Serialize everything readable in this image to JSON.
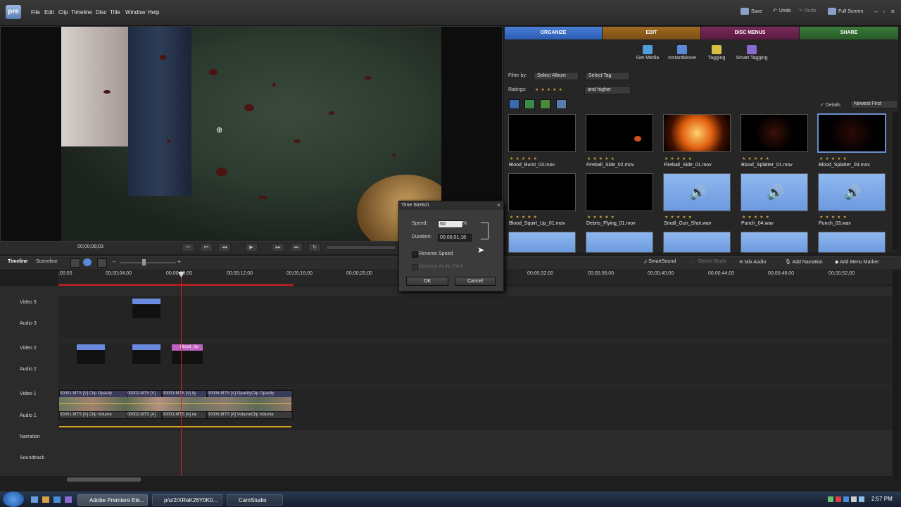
{
  "app": {
    "logo": "pre"
  },
  "menu": [
    "File",
    "Edit",
    "Clip",
    "Timeline",
    "Disc",
    "Title",
    "Window",
    "Help"
  ],
  "toolbar": {
    "save": "Save",
    "undo": "Undo",
    "redo": "Redo",
    "fullscreen": "Full Screen"
  },
  "monitor": {
    "timecode": "00;00;08;03"
  },
  "tabs": {
    "organize": "ORGANIZE",
    "edit": "EDIT",
    "disc_menus": "DISC MENUS",
    "share": "SHARE"
  },
  "tools": {
    "get_media": "Get Media",
    "instant_movie": "InstantMovie",
    "tagging": "Tagging",
    "smart_tagging": "Smart Tagging"
  },
  "filter": {
    "filter_by": "Filter by:",
    "album": "Select Album",
    "tag": "Select Tag",
    "ratings": "Ratings:",
    "and_higher": "and higher",
    "details": "Details",
    "sort": "Newest First"
  },
  "media": [
    {
      "name": "Blood_Burst_03.mov"
    },
    {
      "name": "Fireball_Side_02.mov"
    },
    {
      "name": "Fireball_Side_01.mov"
    },
    {
      "name": "Blood_Splatter_01.mov"
    },
    {
      "name": "Blood_Splatter_03.mov"
    },
    {
      "name": "Blood_Squirt_Up_01.mov"
    },
    {
      "name": "Debris_Flying_01.mov"
    },
    {
      "name": "Small_Gun_Shot.wav"
    },
    {
      "name": "Punch_04.wav"
    },
    {
      "name": "Punch_03.wav"
    }
  ],
  "dialog": {
    "title": "Time Stretch",
    "speed_label": "Speed:",
    "speed_value": "50",
    "speed_unit": "%",
    "duration_label": "Duration:",
    "duration_value": "00;00;01;18",
    "reverse": "Reverse Speed",
    "maintain": "Maintain Audio Pitch",
    "ok": "OK",
    "cancel": "Cancel"
  },
  "timeline": {
    "tab_timeline": "Timeline",
    "tab_sceneline": "Sceneline",
    "smartsound": "SmartSound",
    "detect_beats": "Detect Beats",
    "mix_audio": "Mix Audio",
    "add_narration": "Add Narration",
    "add_menu_marker": "Add Menu Marker",
    "ticks": [
      ";00;00",
      "00;00;04;00",
      "00;00;08;00",
      "00;00;12;00",
      "00;00;16;00",
      "00;00;20;00",
      "00;00;32;00",
      "00;00;36;00",
      "00;00;40;00",
      "00;00;44;00",
      "00;00;48;00",
      "00;00;52;00"
    ],
    "tracks": [
      "Video 3",
      "Audio 3",
      "Video 2",
      "Audio 2",
      "Video 1",
      "Audio 1",
      "Narration",
      "Soundtrack"
    ],
    "clips": {
      "v2c": "Blood_Sp",
      "v1a": "00001.MTS [V] Clip Opacity",
      "v1b": "00002.MTS [V]",
      "v1c": "00003.MTS [V] ity",
      "v1d": "00006.MTS [V] OpacityClip Opacity",
      "a1a": "00001.MTS [A] Clip Volume",
      "a1b": "00002.MTS [A]",
      "a1c": "00003.MTS [A] ne",
      "a1d": "00006.MTS [A] VolumeClip Volume"
    }
  },
  "taskbar": {
    "premiere": "Adobe Premiere Ele...",
    "browser": "p/u/2/XRaK26Y0K0...",
    "camstudio": "CamStudio",
    "time": "2:57 PM"
  }
}
